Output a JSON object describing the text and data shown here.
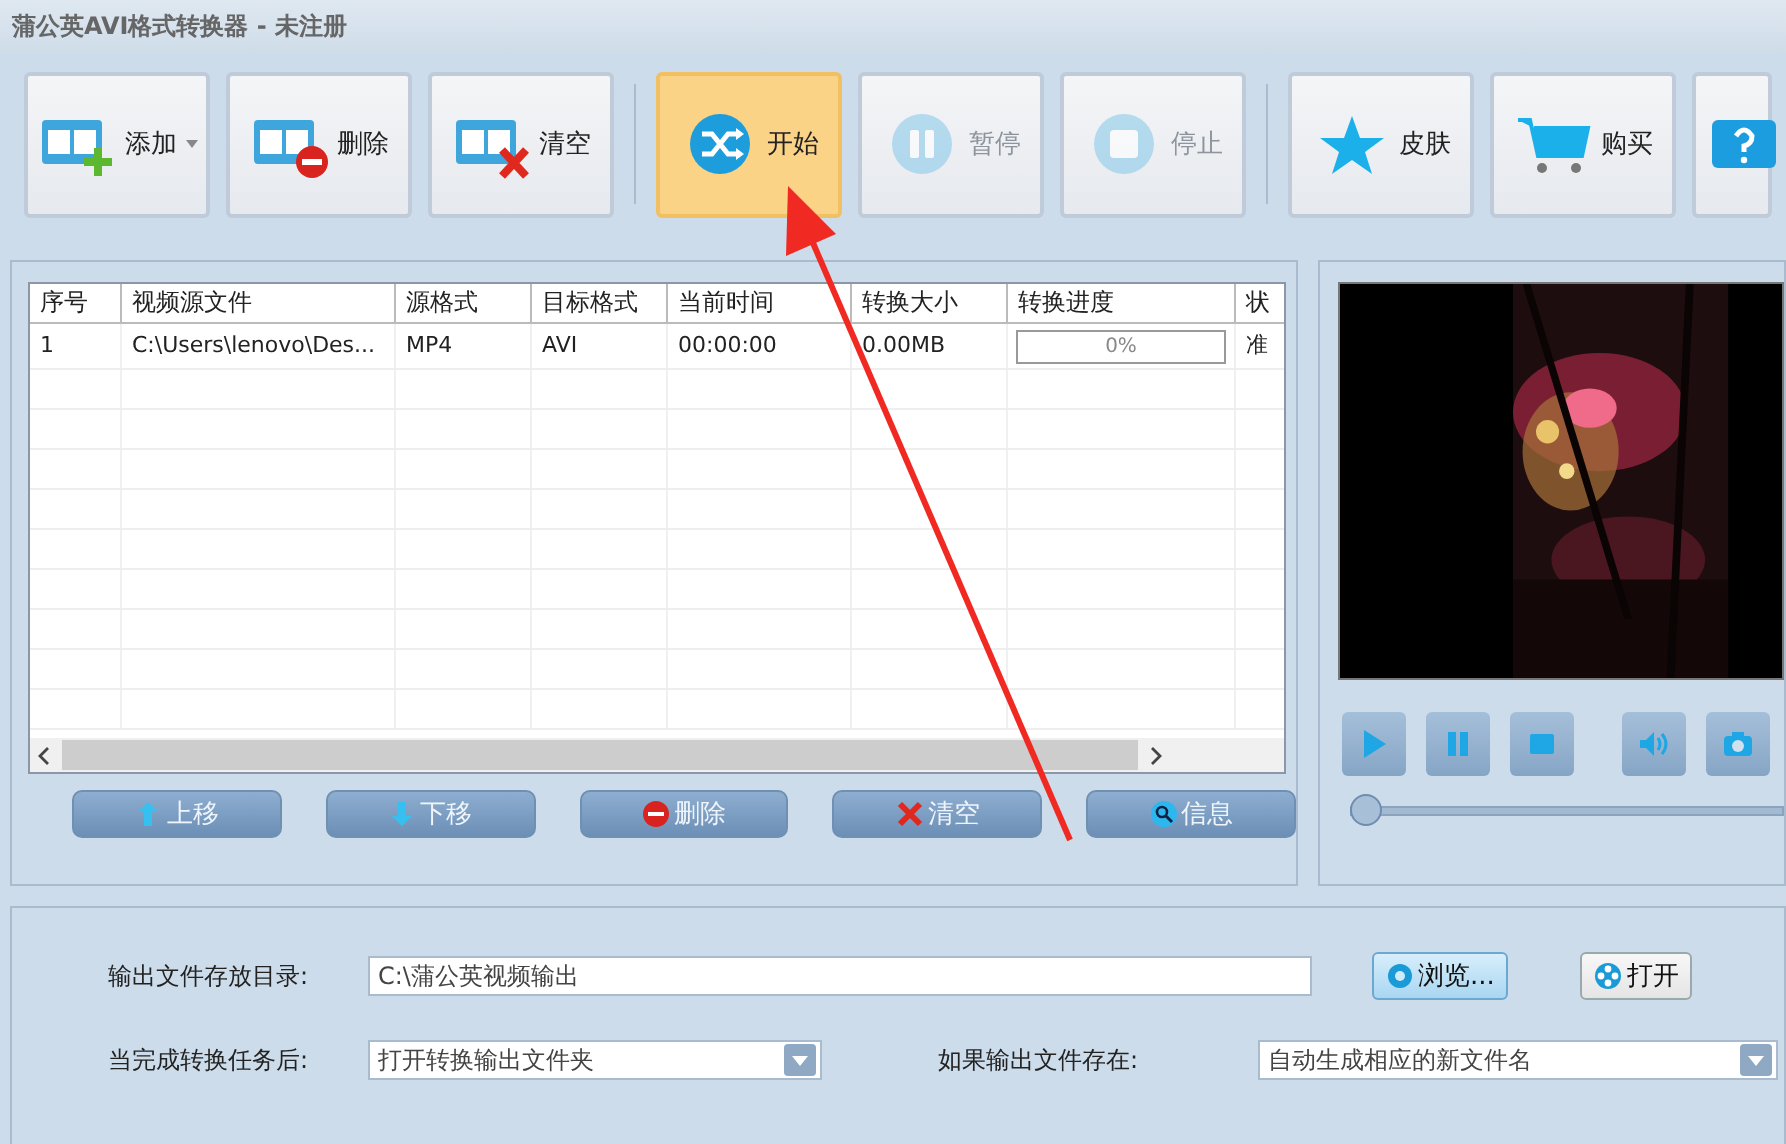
{
  "window": {
    "title": "蒲公英AVI格式转换器 - 未注册"
  },
  "toolbar": [
    {
      "kind": "add",
      "label": "添加",
      "dropdown": true,
      "selected": false,
      "disabled": false
    },
    {
      "kind": "delete",
      "label": "删除",
      "selected": false,
      "disabled": false
    },
    {
      "kind": "clear",
      "label": "清空",
      "selected": false,
      "disabled": false
    },
    {
      "kind": "separator"
    },
    {
      "kind": "start",
      "label": "开始",
      "selected": true,
      "disabled": false
    },
    {
      "kind": "pause",
      "label": "暂停",
      "selected": false,
      "disabled": true
    },
    {
      "kind": "stop",
      "label": "停止",
      "selected": false,
      "disabled": true
    },
    {
      "kind": "separator"
    },
    {
      "kind": "skin",
      "label": "皮肤",
      "selected": false,
      "disabled": false
    },
    {
      "kind": "buy",
      "label": "购买",
      "selected": false,
      "disabled": false
    },
    {
      "kind": "help",
      "selected": false,
      "disabled": false
    }
  ],
  "table": {
    "columns": [
      "序号",
      "视频源文件",
      "源格式",
      "目标格式",
      "当前时间",
      "转换大小",
      "转换进度",
      "状"
    ],
    "rows": [
      {
        "index": "1",
        "source": "C:\\Users\\lenovo\\Des...",
        "source_format": "MP4",
        "target_format": "AVI",
        "current_time": "00:00:00",
        "size": "0.00MB",
        "progress": {
          "level": 0,
          "reading": "0%"
        },
        "status": "准"
      }
    ]
  },
  "list_buttons": [
    {
      "kind": "up",
      "label": "上移"
    },
    {
      "kind": "down",
      "label": "下移"
    },
    {
      "kind": "delete",
      "label": "删除"
    },
    {
      "kind": "clear",
      "label": "清空"
    },
    {
      "kind": "info",
      "label": "信息"
    }
  ],
  "player": {
    "controls": [
      {
        "kind": "play"
      },
      {
        "kind": "pause"
      },
      {
        "kind": "stop"
      },
      {
        "kind": "volume"
      },
      {
        "kind": "snapshot"
      }
    ],
    "position": {
      "level": 0
    }
  },
  "output": {
    "directory_label": "输出文件存放目录:",
    "directory": "C:\\蒲公英视频输出",
    "browse": "浏览...",
    "open": "打开",
    "after_label": "当完成转换任务后:",
    "after_value": "打开转换输出文件夹",
    "exists_label": "如果输出文件存在:",
    "exists_value": "自动生成相应的新文件名"
  }
}
